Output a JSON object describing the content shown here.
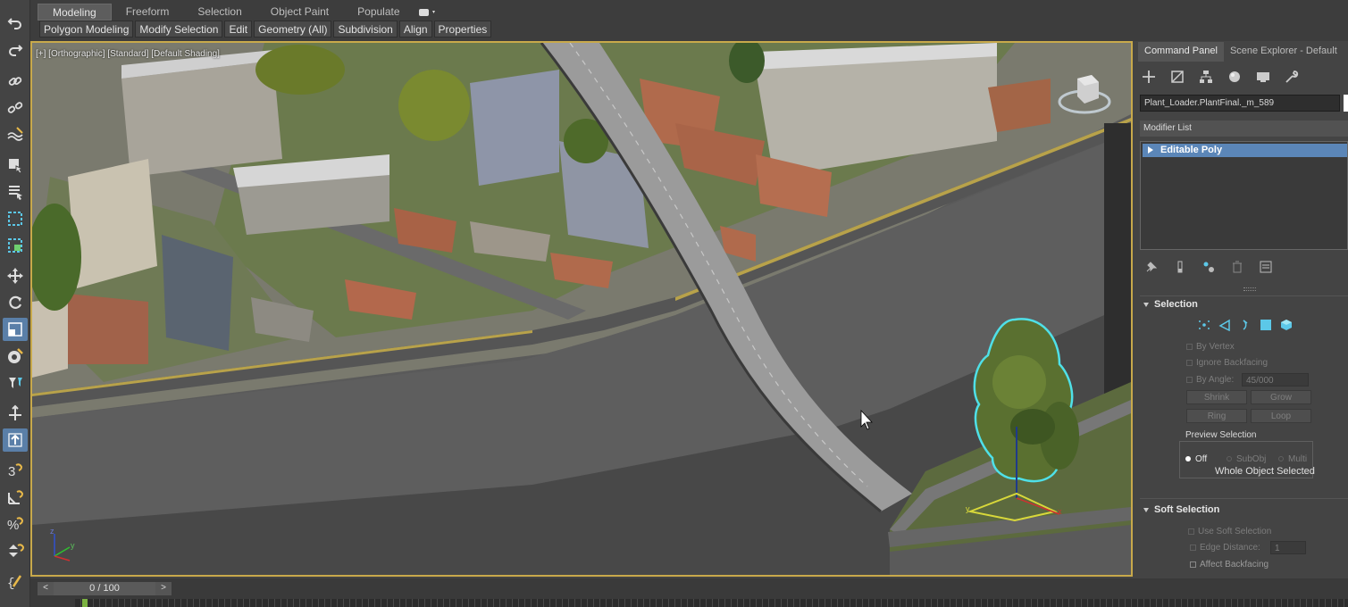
{
  "ribbon": {
    "tabs": [
      "Modeling",
      "Freeform",
      "Selection",
      "Object Paint",
      "Populate"
    ],
    "subtabs": [
      "Polygon Modeling",
      "Modify Selection",
      "Edit",
      "Geometry (All)",
      "Subdivision",
      "Align",
      "Properties"
    ]
  },
  "viewport": {
    "label": "[+] [Orthographic] [Standard] [Default Shading]",
    "axis_x": "x",
    "axis_y": "y",
    "axis_z": "z"
  },
  "command_panel": {
    "tabs": [
      "Command Panel",
      "Scene Explorer - Default"
    ],
    "object_name": "Plant_Loader.PlantFinal._m_589",
    "object_color": "#ffffff",
    "modifier_list_label": "Modifier List",
    "stack_item": "Editable Poly",
    "selection": {
      "title": "Selection",
      "by_vertex": "By Vertex",
      "ignore_backfacing": "Ignore Backfacing",
      "by_angle": "By Angle:",
      "angle_value": "45/000",
      "shrink": "Shrink",
      "grow": "Grow",
      "ring": "Ring",
      "loop": "Loop",
      "preview_title": "Preview Selection",
      "preview_off": "Off",
      "preview_subobj": "SubObj",
      "preview_multi": "Multi",
      "status": "Whole Object Selected"
    },
    "soft_selection": {
      "title": "Soft Selection",
      "use_soft": "Use Soft Selection",
      "edge_distance": "Edge Distance:",
      "edge_value": "1",
      "affect_backfacing": "Affect Backfacing"
    }
  },
  "timeline": {
    "range": "0 / 100",
    "prev": "<",
    "next": ">"
  },
  "colors": {
    "viewport_border": "#c8a94b",
    "selection_highlight": "#4fe0e8",
    "active_stack": "#5b86b8"
  }
}
